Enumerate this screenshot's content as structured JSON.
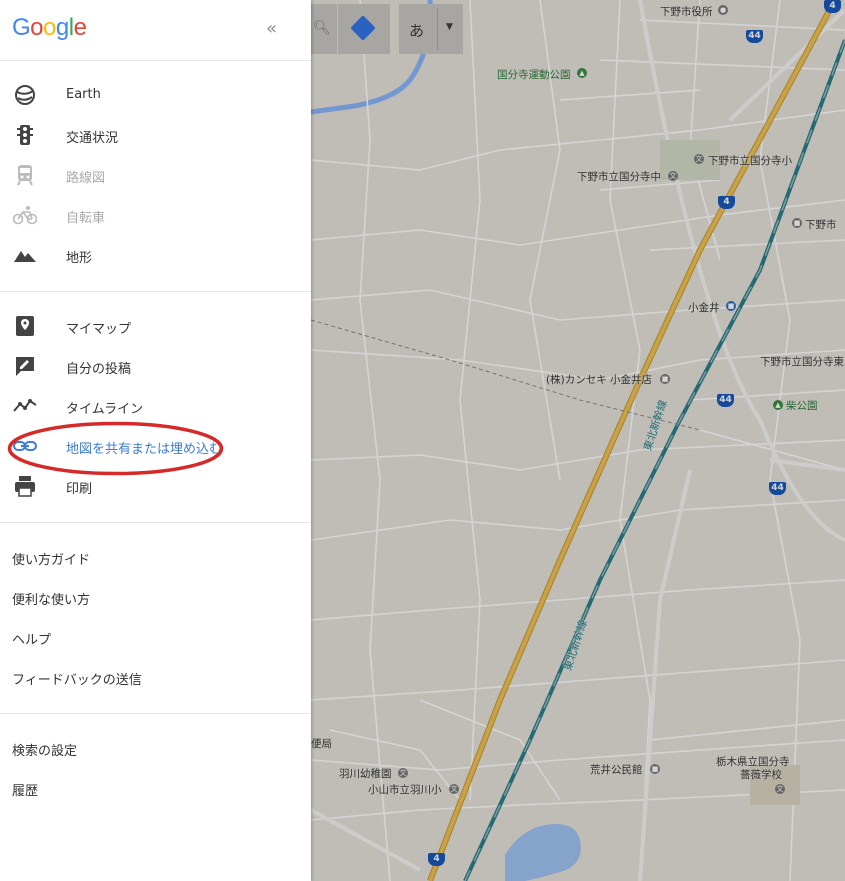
{
  "panel": {
    "logo_letters": [
      {
        "ch": "G",
        "color": "#4285F4"
      },
      {
        "ch": "o",
        "color": "#EA4335"
      },
      {
        "ch": "o",
        "color": "#FBBC05"
      },
      {
        "ch": "g",
        "color": "#4285F4"
      },
      {
        "ch": "l",
        "color": "#34A853"
      },
      {
        "ch": "e",
        "color": "#EA4335"
      }
    ],
    "collapse_label": "«",
    "layers": [
      {
        "label": "Earth",
        "icon": "earth-icon",
        "enabled": true
      },
      {
        "label": "交通状況",
        "icon": "traffic-light-icon",
        "enabled": true
      },
      {
        "label": "路線図",
        "icon": "train-icon",
        "enabled": false
      },
      {
        "label": "自転車",
        "icon": "bicycle-icon",
        "enabled": false
      },
      {
        "label": "地形",
        "icon": "terrain-icon",
        "enabled": true
      }
    ],
    "tools": [
      {
        "label": "マイマップ",
        "icon": "my-maps-icon"
      },
      {
        "label": "自分の投稿",
        "icon": "contribution-icon"
      },
      {
        "label": "タイムライン",
        "icon": "timeline-icon"
      },
      {
        "label": "地図を共有または埋め込む",
        "icon": "link-icon",
        "highlighted": true
      },
      {
        "label": "印刷",
        "icon": "print-icon"
      }
    ],
    "help_links": [
      "使い方ガイド",
      "便利な使い方",
      "ヘルプ",
      "フィードバックの送信"
    ],
    "settings_links": [
      "検索の設定",
      "履歴"
    ]
  },
  "map": {
    "input_mode_label": "あ",
    "labels": {
      "city_hall": "下野市役所",
      "park": "国分寺運動公園",
      "es1": "下野市立国分寺小",
      "jhs": "下野市立国分寺中",
      "shimono_right": "下野市",
      "koganei": "小金井",
      "kanseki": "(株)カンセキ 小金井店",
      "shimono_east": "下野市立国分寺東",
      "shiba_park": "柴公園",
      "yubin": "便局",
      "hanekawa_kg": "羽川幼稚園",
      "hanekawa_es": "小山市立羽川小",
      "arai": "荒井公民館",
      "tochigi_school_1": "栃木県立国分寺",
      "tochigi_school_2": "薔薇学校",
      "rail1": "東北新幹線",
      "rail2": "東北新幹線"
    },
    "route_shields": {
      "r4": "4",
      "r44": "44"
    }
  },
  "colors": {
    "link": "#3a7bd5",
    "highlight_ring": "#d62a2a",
    "road_yellow": "#e4b43a",
    "rail_teal": "#2a7f8a"
  }
}
